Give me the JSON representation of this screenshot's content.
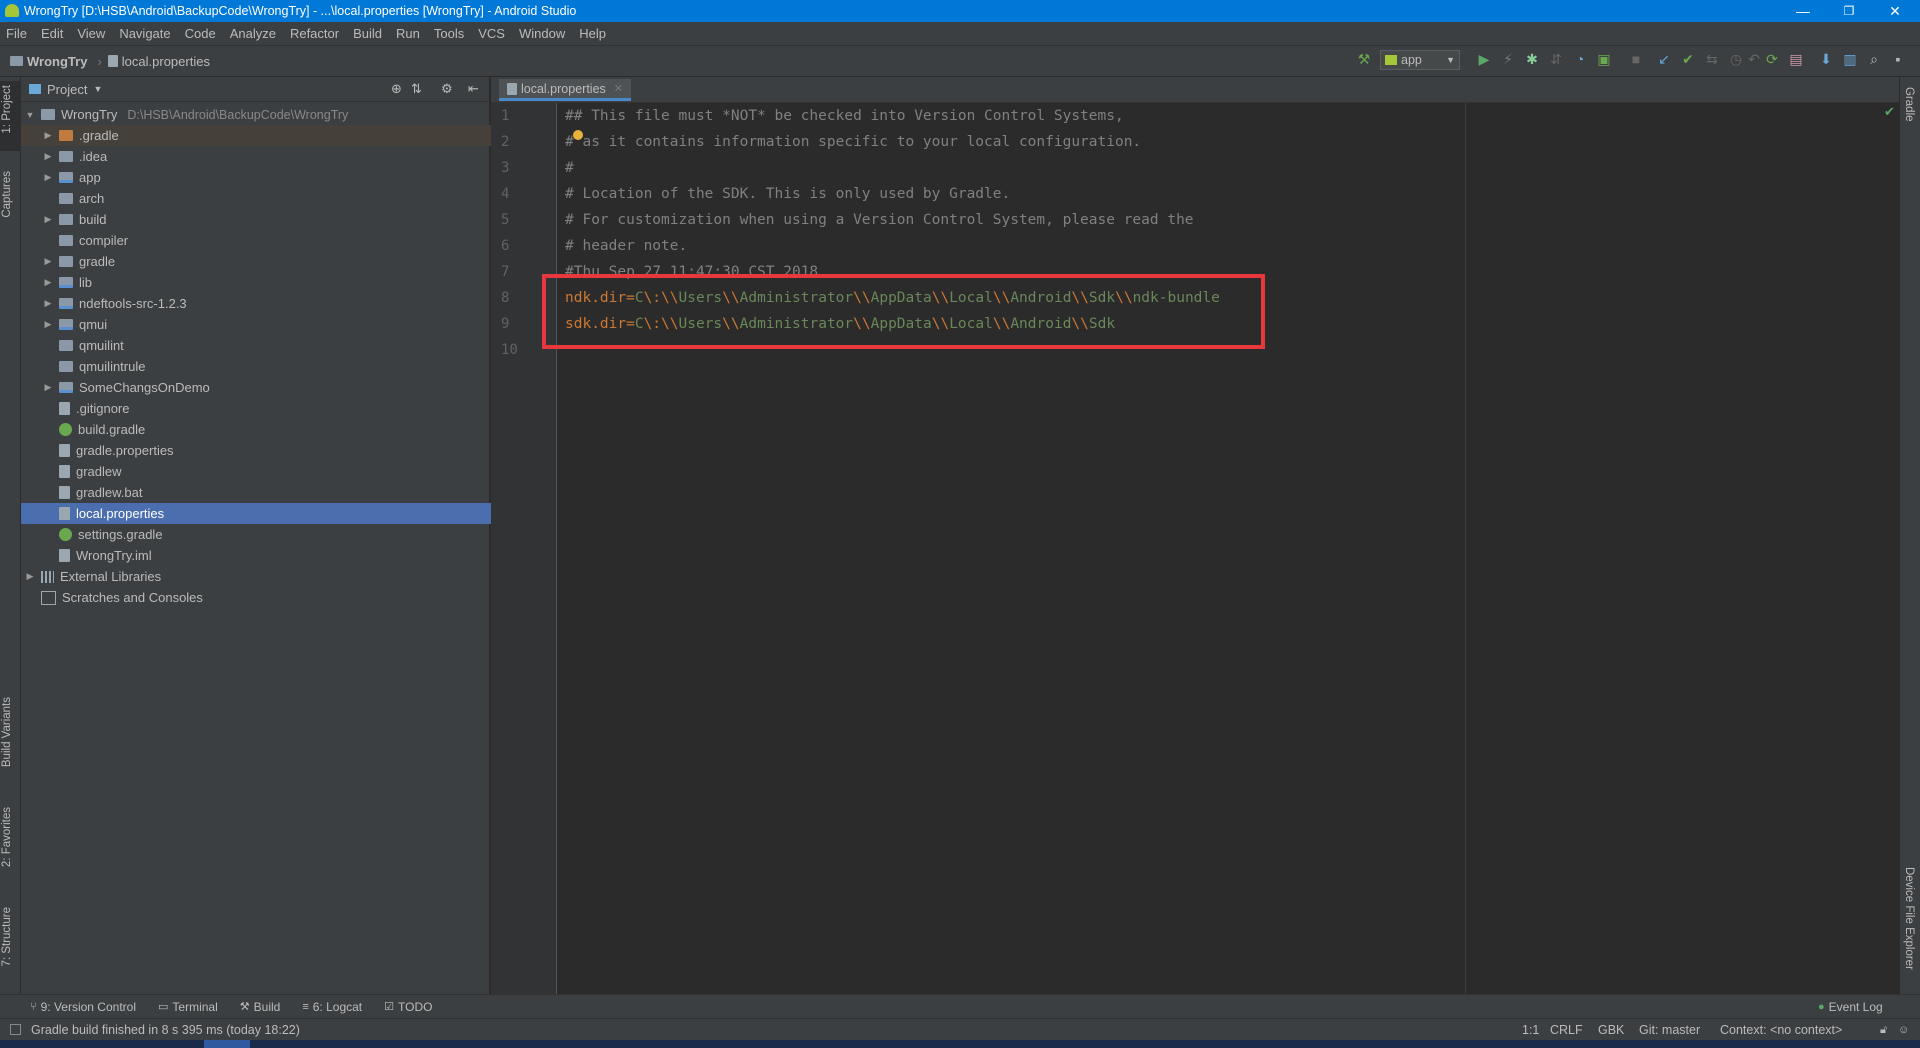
{
  "window": {
    "title": "WrongTry [D:\\HSB\\Android\\BackupCode\\WrongTry] - ...\\local.properties [WrongTry] - Android Studio",
    "minimize": "—",
    "maximize": "❐",
    "close": "✕"
  },
  "menu": [
    "File",
    "Edit",
    "View",
    "Navigate",
    "Code",
    "Analyze",
    "Refactor",
    "Build",
    "Run",
    "Tools",
    "VCS",
    "Window",
    "Help"
  ],
  "breadcrumb": {
    "project": "WrongTry",
    "file": "local.properties"
  },
  "toolbar": {
    "run_config": "app"
  },
  "left_tabs": {
    "project": "1: Project",
    "captures": "Captures",
    "build_variants": "Build Variants",
    "favorites": "2: Favorites",
    "structure": "7: Structure"
  },
  "right_tabs": {
    "gradle": "Gradle",
    "device_explorer": "Device File Explorer"
  },
  "project_panel": {
    "title": "Project",
    "root": {
      "name": "WrongTry",
      "path": "D:\\HSB\\Android\\BackupCode\\WrongTry"
    },
    "items": [
      {
        "label": ".gradle",
        "icon": "folder-orange",
        "expandable": true
      },
      {
        "label": ".idea",
        "icon": "folder",
        "expandable": true
      },
      {
        "label": "app",
        "icon": "module",
        "expandable": true
      },
      {
        "label": "arch",
        "icon": "folder",
        "expandable": false
      },
      {
        "label": "build",
        "icon": "folder",
        "expandable": true
      },
      {
        "label": "compiler",
        "icon": "folder",
        "expandable": false
      },
      {
        "label": "gradle",
        "icon": "folder",
        "expandable": true
      },
      {
        "label": "lib",
        "icon": "module",
        "expandable": true
      },
      {
        "label": "ndeftools-src-1.2.3",
        "icon": "module",
        "expandable": true
      },
      {
        "label": "qmui",
        "icon": "module",
        "expandable": true
      },
      {
        "label": "qmuilint",
        "icon": "folder",
        "expandable": false
      },
      {
        "label": "qmuilintrule",
        "icon": "folder",
        "expandable": false
      },
      {
        "label": "SomeChangsOnDemo",
        "icon": "module",
        "expandable": true
      },
      {
        "label": ".gitignore",
        "icon": "file",
        "expandable": false
      },
      {
        "label": "build.gradle",
        "icon": "gradle",
        "expandable": false
      },
      {
        "label": "gradle.properties",
        "icon": "file",
        "expandable": false
      },
      {
        "label": "gradlew",
        "icon": "file",
        "expandable": false
      },
      {
        "label": "gradlew.bat",
        "icon": "file",
        "expandable": false
      },
      {
        "label": "local.properties",
        "icon": "file",
        "expandable": false
      },
      {
        "label": "settings.gradle",
        "icon": "gradle",
        "expandable": false
      },
      {
        "label": "WrongTry.iml",
        "icon": "file",
        "expandable": false
      }
    ],
    "external": "External Libraries",
    "scratches": "Scratches and Consoles"
  },
  "editor": {
    "tab": "local.properties",
    "line_numbers": [
      "1",
      "2",
      "3",
      "4",
      "5",
      "6",
      "7",
      "8",
      "9",
      "10"
    ],
    "comments": [
      "## This file must *NOT* be checked into Version Control Systems,",
      "# as it contains information specific to your local configuration.",
      "#",
      "# Location of the SDK. This is only used by Gradle.",
      "# For customization when using a Version Control System, please read the",
      "# header note.",
      "#Thu Sep 27 11:47:30 CST 2018"
    ],
    "ndk": {
      "key": "ndk.dir",
      "eq": "=",
      "parts": [
        "C",
        "\\:",
        "\\\\",
        "Users",
        "\\\\",
        "Administrator",
        "\\\\",
        "AppData",
        "\\\\",
        "Local",
        "\\\\",
        "Android",
        "\\\\",
        "Sdk",
        "\\\\",
        "ndk-bundle"
      ]
    },
    "sdk": {
      "key": "sdk.dir",
      "eq": "=",
      "parts": [
        "C",
        "\\:",
        "\\\\",
        "Users",
        "\\\\",
        "Administrator",
        "\\\\",
        "AppData",
        "\\\\",
        "Local",
        "\\\\",
        "Android",
        "\\\\",
        "Sdk"
      ]
    }
  },
  "bottom_tools": {
    "vcs": "9: Version Control",
    "terminal": "Terminal",
    "build": "Build",
    "logcat": "6: Logcat",
    "todo": "TODO",
    "event_log": "Event Log"
  },
  "status": {
    "message": "Gradle build finished in 8 s 395 ms (today 18:22)",
    "position": "1:1",
    "line_sep": "CRLF",
    "encoding": "GBK",
    "git": "Git: master",
    "context": "Context: <no context>"
  },
  "colors": {
    "title_bar": "#0078d7",
    "selection": "#4b6eaf",
    "highlight_box": "#e8383d",
    "keyword": "#cc7832",
    "string": "#6a8759",
    "comment": "#808080"
  }
}
